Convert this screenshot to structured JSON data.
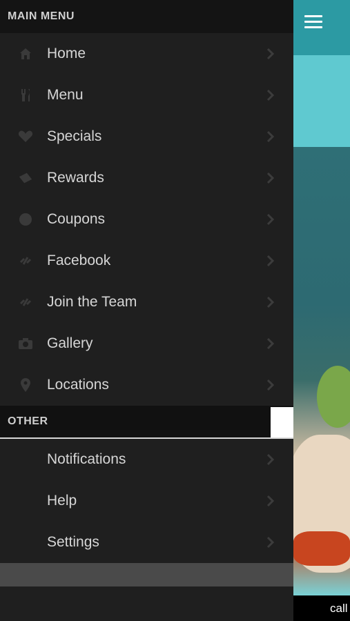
{
  "main_menu": {
    "header": "MAIN MENU",
    "items": [
      {
        "label": "Home",
        "icon": "home-icon"
      },
      {
        "label": "Menu",
        "icon": "utensils-icon"
      },
      {
        "label": "Specials",
        "icon": "heart-icon"
      },
      {
        "label": "Rewards",
        "icon": "ticket-icon"
      },
      {
        "label": "Coupons",
        "icon": "coupon-circle-icon"
      },
      {
        "label": "Facebook",
        "icon": "link-icon"
      },
      {
        "label": "Join the Team",
        "icon": "link-icon"
      },
      {
        "label": "Gallery",
        "icon": "camera-icon"
      },
      {
        "label": "Locations",
        "icon": "map-pin-icon"
      }
    ]
  },
  "other_menu": {
    "header": "OTHER",
    "items": [
      {
        "label": "Notifications"
      },
      {
        "label": "Help"
      },
      {
        "label": "Settings"
      }
    ]
  },
  "background_panel": {
    "bottom_text": "call"
  },
  "colors": {
    "drawer_bg": "#1f1f1f",
    "header_bg": "#141414",
    "text": "#d6d6d6",
    "accent_teal": "#2c9aa3",
    "banner_teal": "#5fc9d0"
  }
}
